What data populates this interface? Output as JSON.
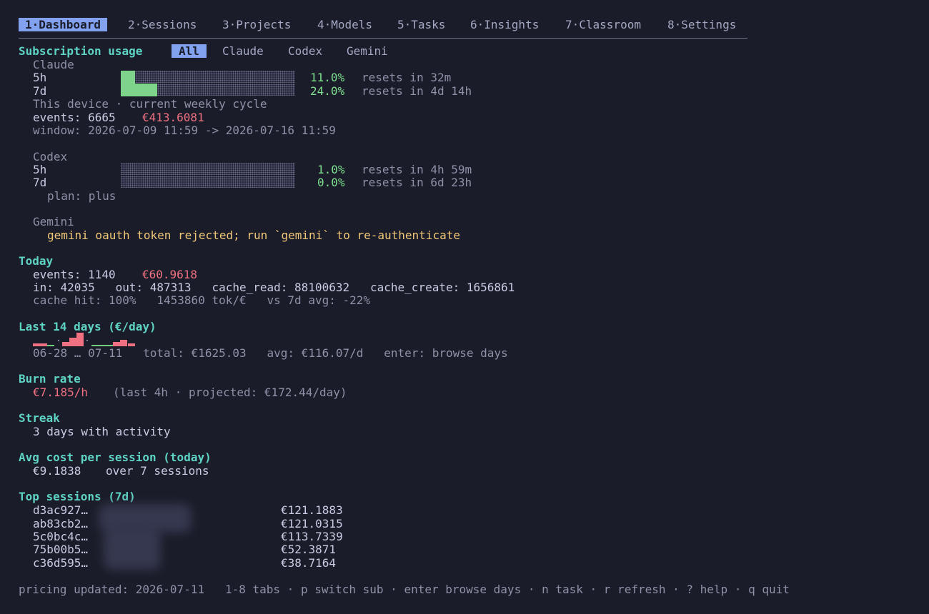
{
  "tabs": [
    {
      "label": "1·Dashboard",
      "active": true
    },
    {
      "label": "2·Sessions"
    },
    {
      "label": "3·Projects"
    },
    {
      "label": "4·Models"
    },
    {
      "label": "5·Tasks"
    },
    {
      "label": "6·Insights"
    },
    {
      "label": "7·Classroom"
    },
    {
      "label": "8·Settings"
    }
  ],
  "subscription": {
    "title": "Subscription usage",
    "filters": [
      "All",
      "Claude",
      "Codex",
      "Gemini"
    ],
    "active_filter": "All",
    "claude": {
      "name": "Claude",
      "rows": [
        {
          "label": "5h",
          "pct_text": "11.0%",
          "pct": 0.11,
          "reset": "resets in 32m"
        },
        {
          "label": "7d",
          "pct_text": "24.0%",
          "pct": 0.24,
          "reset": "resets in 4d 14h"
        }
      ],
      "device_note": "This device · current weekly cycle",
      "events_label": "events: 6665",
      "events_cost": "€413.6081",
      "window": "window: 2026-07-09 11:59 -> 2026-07-16 11:59"
    },
    "codex": {
      "name": "Codex",
      "rows": [
        {
          "label": "5h",
          "pct_text": "1.0%",
          "pct": 0.01,
          "reset": "resets in 4h 59m"
        },
        {
          "label": "7d",
          "pct_text": "0.0%",
          "pct": 0.0,
          "reset": "resets in 6d 23h"
        }
      ],
      "plan": "plan: plus"
    },
    "gemini": {
      "name": "Gemini",
      "error": "gemini oauth token rejected; run `gemini` to re-authenticate"
    }
  },
  "today": {
    "title": "Today",
    "events_label": "events: 1140",
    "events_cost": "€60.9618",
    "tokens": "in: 42035   out: 487313   cache_read: 88100632   cache_create: 1656861",
    "cache": "cache hit: 100%   1453860 tok/€   vs 7d avg: -22%"
  },
  "last14": {
    "title": "Last 14 days (€/day)",
    "summary": "06-28 … 07-11   total: €1625.03   avg: €116.07/d   enter: browse days",
    "chart_data": {
      "type": "bar",
      "categories": [
        "06-28",
        "06-29",
        "06-30",
        "07-01",
        "07-02",
        "07-03",
        "07-04",
        "07-05",
        "07-06",
        "07-07",
        "07-08",
        "07-09",
        "07-10",
        "07-11"
      ],
      "values": [
        80,
        80,
        5,
        0,
        110,
        240,
        370,
        0,
        5,
        5,
        5,
        110,
        180,
        80
      ]
    }
  },
  "burn": {
    "title": "Burn rate",
    "rate": "€7.185/h",
    "detail": "(last 4h · projected: €172.44/day)"
  },
  "streak": {
    "title": "Streak",
    "text": "3 days with activity"
  },
  "avg_session": {
    "title": "Avg cost per session (today)",
    "value": "€9.1838",
    "detail": "over 7 sessions"
  },
  "top_sessions": {
    "title": "Top sessions (7d)",
    "rows": [
      {
        "id": "d3ac927…",
        "cost": "€121.1883"
      },
      {
        "id": "ab83cb2…",
        "cost": "€121.0315"
      },
      {
        "id": "5c0bc4c…",
        "cost": "€113.7339"
      },
      {
        "id": "75b00b5…",
        "cost": "€52.3871"
      },
      {
        "id": "c36d595…",
        "cost": "€38.7164"
      }
    ]
  },
  "footer": "pricing updated: 2026-07-11   1-8 tabs · p switch sub · enter browse days · n task · r refresh · ? help · q quit"
}
